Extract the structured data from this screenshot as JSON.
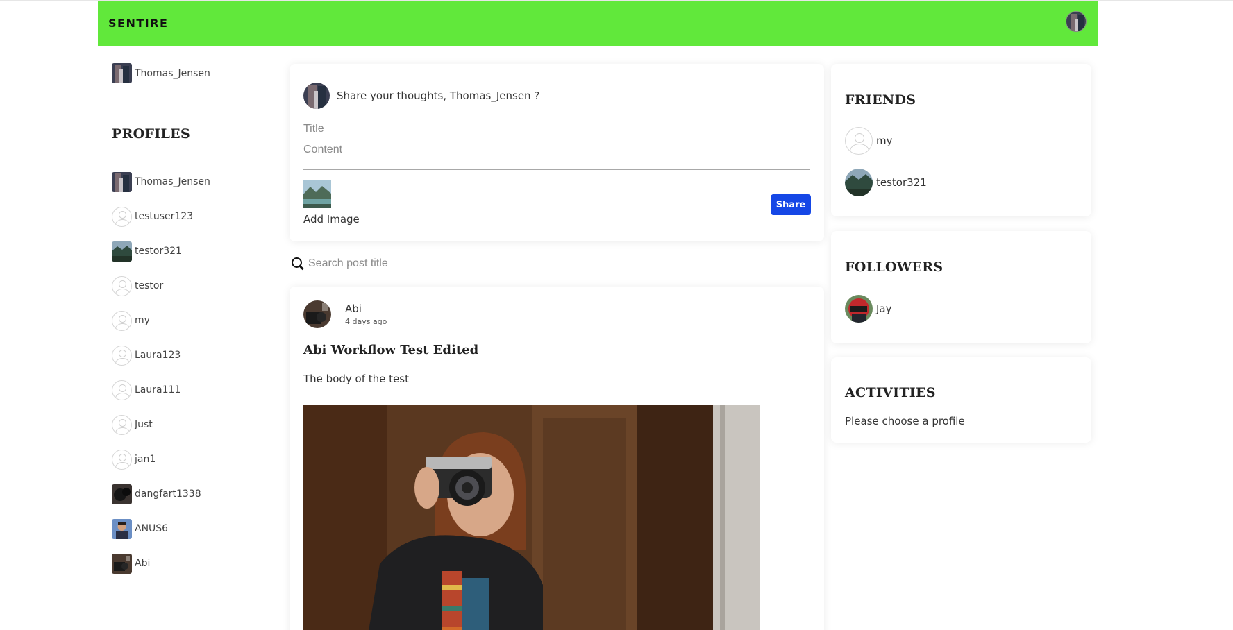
{
  "app": {
    "brand": "SENTIRE"
  },
  "current_user": {
    "name": "Thomas_Jensen"
  },
  "sidebar": {
    "profiles_title": "PROFILES",
    "profiles": [
      {
        "name": "Thomas_Jensen",
        "avatar": "photo-guitar"
      },
      {
        "name": "testuser123",
        "avatar": "default"
      },
      {
        "name": "testor321",
        "avatar": "photo-landscape"
      },
      {
        "name": "testor",
        "avatar": "default"
      },
      {
        "name": "my",
        "avatar": "default"
      },
      {
        "name": "Laura123",
        "avatar": "default"
      },
      {
        "name": "Laura111",
        "avatar": "default"
      },
      {
        "name": "Just",
        "avatar": "default"
      },
      {
        "name": "jan1",
        "avatar": "default"
      },
      {
        "name": "dangfart1338",
        "avatar": "photo-dark"
      },
      {
        "name": "ANUS6",
        "avatar": "photo-portrait"
      },
      {
        "name": "Abi",
        "avatar": "photo-abi"
      }
    ]
  },
  "composer": {
    "prompt": "Share your thoughts, Thomas_Jensen ?",
    "title_placeholder": "Title",
    "content_placeholder": "Content",
    "add_image_label": "Add Image",
    "share_label": "Share"
  },
  "search": {
    "placeholder": "Search post title"
  },
  "post": {
    "author": "Abi",
    "time": "4 days ago",
    "title": "Abi Workflow Test Edited",
    "body": "The body of the test"
  },
  "friends": {
    "title": "FRIENDS",
    "items": [
      {
        "name": "my",
        "avatar": "default"
      },
      {
        "name": "testor321",
        "avatar": "photo-landscape"
      }
    ]
  },
  "followers": {
    "title": "FOLLOWERS",
    "items": [
      {
        "name": "Jay",
        "avatar": "photo-helmet"
      }
    ]
  },
  "activities": {
    "title": "ACTIVITIES",
    "text": "Please choose a profile"
  },
  "colors": {
    "navbar": "#61e83b",
    "share_button": "#1547e6"
  }
}
